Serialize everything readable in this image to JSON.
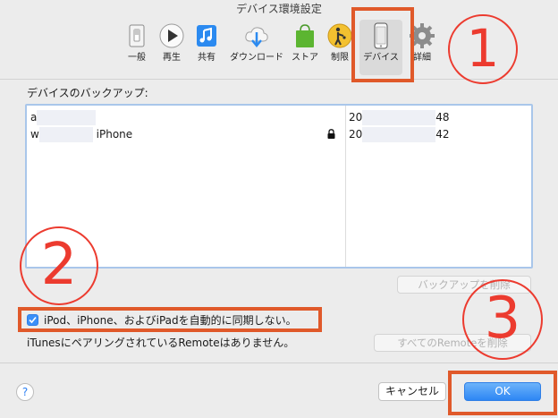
{
  "window": {
    "title": "デバイス環境設定"
  },
  "toolbar": {
    "items": [
      {
        "label": "一般",
        "icon": "general-switch-icon"
      },
      {
        "label": "再生",
        "icon": "play-icon"
      },
      {
        "label": "共有",
        "icon": "music-share-icon"
      },
      {
        "label": "ダウンロード",
        "icon": "cloud-download-icon"
      },
      {
        "label": "ストア",
        "icon": "store-bag-icon"
      },
      {
        "label": "制限",
        "icon": "restrictions-icon"
      },
      {
        "label": "デバイス",
        "icon": "iphone-icon",
        "selected": true
      },
      {
        "label": "詳細",
        "icon": "gear-icon"
      }
    ]
  },
  "backups": {
    "section_label": "デバイスのバックアップ:",
    "rows": [
      {
        "name_prefix": "a",
        "name_suffix": "",
        "date_prefix": "20",
        "date_suffix": "48",
        "locked": false
      },
      {
        "name_prefix": "w",
        "name_suffix": "iPhone",
        "date_prefix": "20",
        "date_suffix": "42",
        "locked": true
      }
    ],
    "delete_button": "バックアップを削除"
  },
  "sync": {
    "checkbox_label": "iPod、iPhone、およびiPadを自動的に同期しない。",
    "checked": true
  },
  "remote": {
    "status_text": "iTunesにペアリングされているRemoteはありません。",
    "forget_button": "すべてのRemoteを削除"
  },
  "footer": {
    "help": "?",
    "cancel": "キャンセル",
    "ok": "OK"
  },
  "annotations": {
    "step1": "1",
    "step2": "2",
    "step3": "3"
  },
  "colors": {
    "highlight": "#e0592a",
    "annotation_red": "#ec3b2f",
    "accent_blue": "#2d86f4",
    "selection_border": "#a9c6ea"
  }
}
